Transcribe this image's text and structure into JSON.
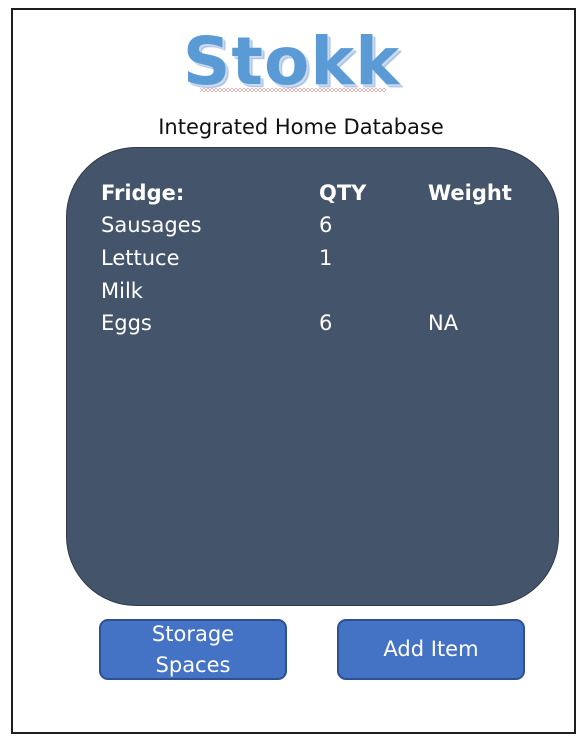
{
  "app": {
    "logo_text": "Stokk",
    "subtitle": "Integrated Home Database"
  },
  "table": {
    "headers": {
      "name": "Fridge:",
      "qty": "QTY",
      "weight": "Weight"
    },
    "rows": [
      {
        "name": "Sausages",
        "qty": "6",
        "weight": ""
      },
      {
        "name": "Lettuce",
        "qty": "1",
        "weight": ""
      },
      {
        "name": "Milk",
        "qty": "",
        "weight": ""
      },
      {
        "name": "Eggs",
        "qty": "6",
        "weight": "NA"
      }
    ]
  },
  "buttons": {
    "storage_label": "Storage Spaces",
    "add_label": "Add Item"
  },
  "colors": {
    "logo": "#5b9bd5",
    "panel": "#44546a",
    "button": "#4472c4",
    "button_border": "#2e528f"
  }
}
